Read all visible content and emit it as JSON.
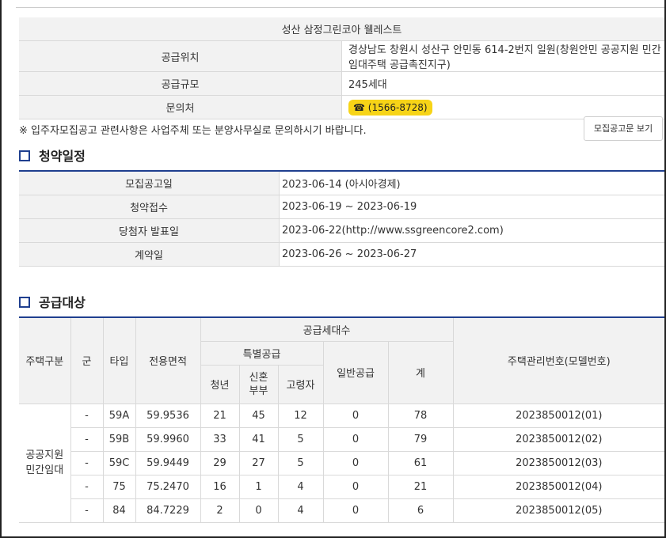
{
  "info": {
    "title": "성산 삼정그린코아 웰레스트",
    "rows": [
      {
        "label": "공급위치",
        "value": "경상남도 창원시 성산구 안민동 614-2번지 일원(창원안민 공공지원 민간임대주택 공급촉진지구)"
      },
      {
        "label": "공급규모",
        "value": "245세대"
      }
    ],
    "contact_label": "문의처",
    "contact_value": "☎ (1566-8728)"
  },
  "notice": "※ 입주자모집공고 관련사항은 사업주체 또는 분양사무실로 문의하시기 바랍니다.",
  "notice_button": "모집공고문 보기",
  "schedule": {
    "title": "청약일정",
    "rows": [
      {
        "label": "모집공고일",
        "value": "2023-06-14 (아시아경제)"
      },
      {
        "label": "청약접수",
        "value": "2023-06-19 ~ 2023-06-19"
      },
      {
        "label": "당첨자 발표일",
        "value": "2023-06-22(http://www.ssgreencore2.com)"
      },
      {
        "label": "계약일",
        "value": "2023-06-26 ~ 2023-06-27"
      }
    ]
  },
  "supply": {
    "title": "공급대상",
    "headers": {
      "housing_type": "주택구분",
      "group": "군",
      "type": "타입",
      "area": "전용면적",
      "supply_count": "공급세대수",
      "special": "특별공급",
      "youth": "청년",
      "newlywed": "신혼\n부부",
      "elderly": "고령자",
      "general": "일반공급",
      "total": "계",
      "mgmt_no": "주택관리번호(모델번호)"
    },
    "housing_type_value": "공공지원\n민간임대",
    "rows": [
      {
        "group": "-",
        "type": "59A",
        "area": "59.9536",
        "youth": "21",
        "newlywed": "45",
        "elderly": "12",
        "general": "0",
        "total": "78",
        "mgmt_no": "2023850012(01)"
      },
      {
        "group": "-",
        "type": "59B",
        "area": "59.9960",
        "youth": "33",
        "newlywed": "41",
        "elderly": "5",
        "general": "0",
        "total": "79",
        "mgmt_no": "2023850012(02)"
      },
      {
        "group": "-",
        "type": "59C",
        "area": "59.9449",
        "youth": "29",
        "newlywed": "27",
        "elderly": "5",
        "general": "0",
        "total": "61",
        "mgmt_no": "2023850012(03)"
      },
      {
        "group": "-",
        "type": "75",
        "area": "75.2470",
        "youth": "16",
        "newlywed": "1",
        "elderly": "4",
        "general": "0",
        "total": "21",
        "mgmt_no": "2023850012(04)"
      },
      {
        "group": "-",
        "type": "84",
        "area": "84.7229",
        "youth": "2",
        "newlywed": "0",
        "elderly": "4",
        "general": "0",
        "total": "6",
        "mgmt_no": "2023850012(05)"
      }
    ]
  },
  "colors": {
    "accent": "#1f3f8f",
    "header_bg": "#f2f2f2",
    "contact_badge": "#f7d417"
  }
}
